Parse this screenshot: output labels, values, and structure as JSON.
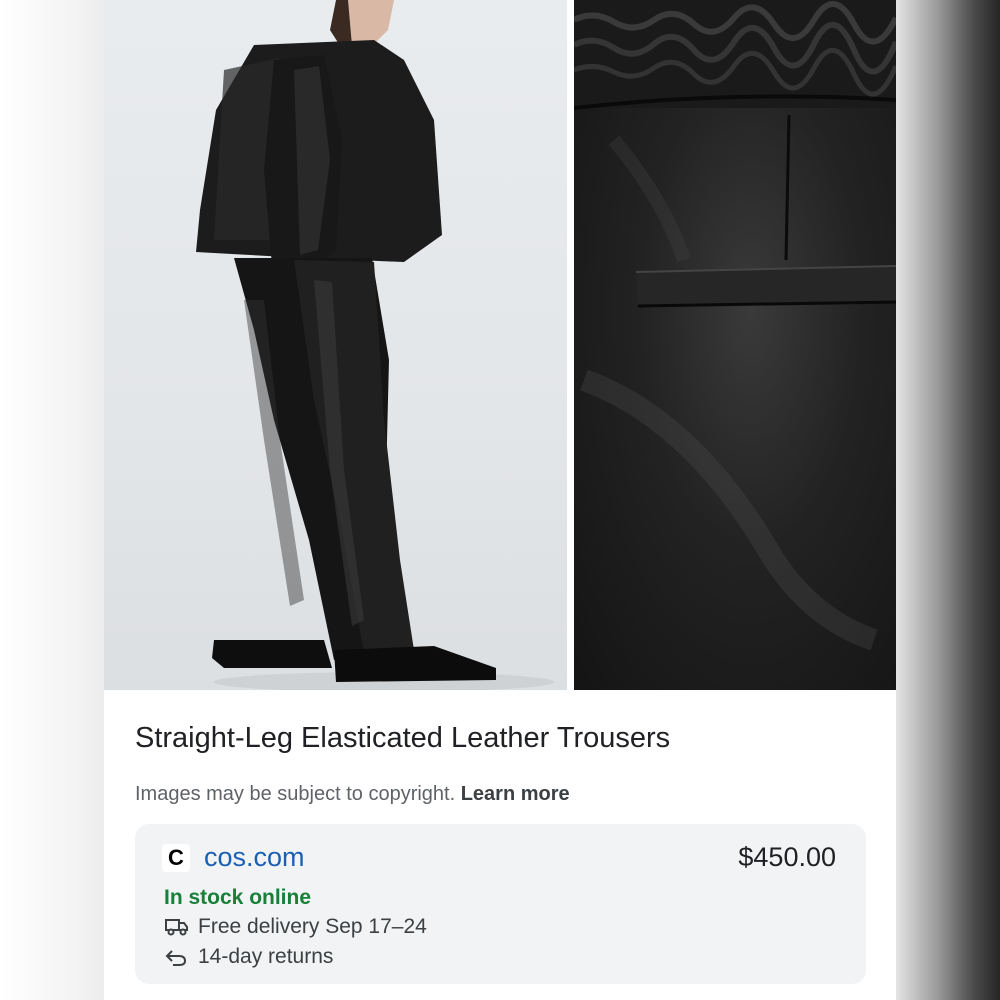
{
  "product": {
    "title": "Straight-Leg Elasticated Leather Trousers",
    "images": [
      {
        "description_name": "model-full-length-photo"
      },
      {
        "description_name": "waistband-pocket-closeup-photo"
      }
    ]
  },
  "copyright": {
    "text": "Images may be subject to copyright.",
    "learn_more": "Learn more"
  },
  "merchant": {
    "logo_letter": "C",
    "site": "cos.com",
    "price": "$450.00",
    "stock": "In stock online",
    "delivery": "Free delivery Sep 17–24",
    "returns": "14-day returns",
    "icons": {
      "delivery": "truck-icon",
      "returns": "return-arrow-icon"
    },
    "colors": {
      "site": "#1a5fb4",
      "stock": "#188038"
    }
  }
}
